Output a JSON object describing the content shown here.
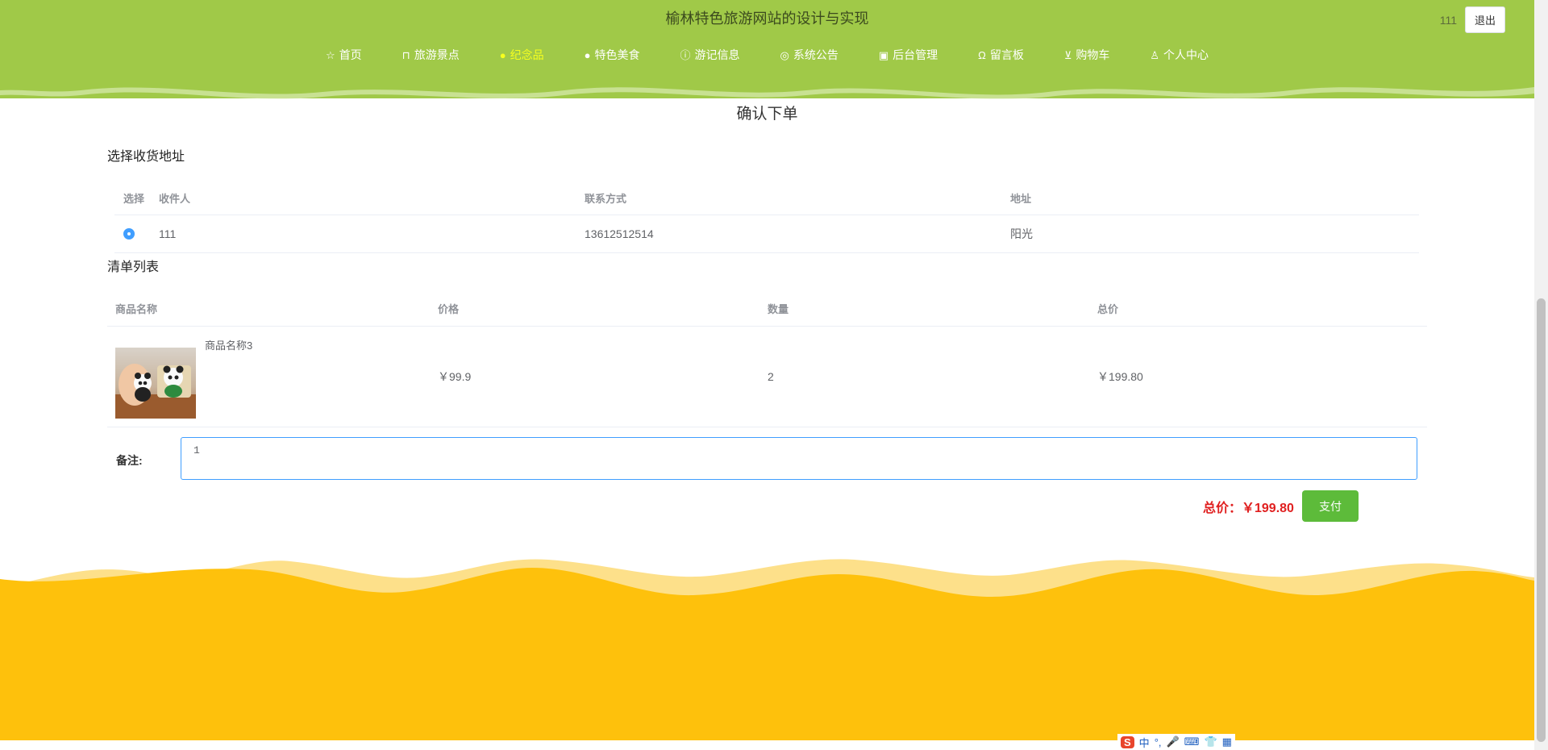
{
  "header": {
    "site_title": "榆林特色旅游网站的设计与实现",
    "user_name": "111",
    "logout_label": "退出",
    "bg_color": "#a0c948",
    "nav": [
      {
        "label": "首页",
        "icon": "star-icon",
        "active": false
      },
      {
        "label": "旅游景点",
        "icon": "bag-icon",
        "active": false
      },
      {
        "label": "纪念品",
        "icon": "circle-icon",
        "active": true
      },
      {
        "label": "特色美食",
        "icon": "circle-icon",
        "active": false
      },
      {
        "label": "游记信息",
        "icon": "info-icon",
        "active": false
      },
      {
        "label": "系统公告",
        "icon": "globe-icon",
        "active": false
      },
      {
        "label": "后台管理",
        "icon": "building-icon",
        "active": false
      },
      {
        "label": "留言板",
        "icon": "headset-icon",
        "active": false
      },
      {
        "label": "购物车",
        "icon": "cart-icon",
        "active": false
      },
      {
        "label": "个人中心",
        "icon": "user-icon",
        "active": false
      }
    ]
  },
  "main": {
    "heading": "确认下单",
    "address_section": {
      "title": "选择收货地址",
      "columns": [
        "选择",
        "收件人",
        "联系方式",
        "地址"
      ],
      "rows": [
        {
          "selected": true,
          "name": "111",
          "phone": "13612512514",
          "address": "阳光"
        }
      ]
    },
    "list_section": {
      "title": "清单列表",
      "columns": [
        "商品名称",
        "价格",
        "数量",
        "总价"
      ],
      "rows": [
        {
          "name": "商品名称3",
          "price": "￥99.9",
          "qty": "2",
          "total": "￥199.80"
        }
      ]
    },
    "remark": {
      "label": "备注:",
      "value": "1"
    },
    "total_text": "总价：￥199.80",
    "pay_label": "支付",
    "accent_green": "#5dbb3a",
    "price_red": "#e02020"
  },
  "ime": {
    "logo": "S",
    "items": [
      "中",
      "°,",
      "🎤",
      "⌨",
      "👕",
      "▦"
    ]
  }
}
